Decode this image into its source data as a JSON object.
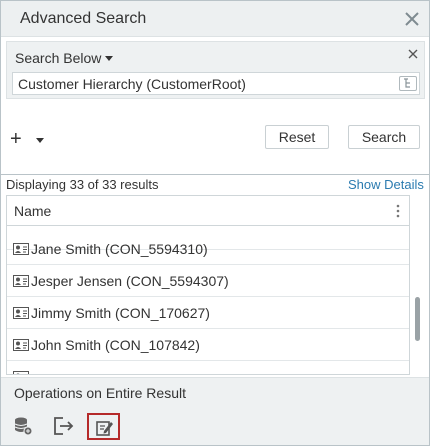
{
  "dialog": {
    "title": "Advanced Search",
    "close_icon": "close-icon"
  },
  "scope": {
    "label": "Search Below",
    "value": "Customer Hierarchy (CustomerRoot)",
    "close_icon": "close-icon",
    "picker_icon": "tree-picker-icon"
  },
  "toolbar": {
    "add_icon": "plus-icon",
    "reset_label": "Reset",
    "search_label": "Search"
  },
  "results": {
    "count_text": "Displaying 33 of 33 results",
    "show_details_label": "Show Details",
    "column_header": "Name",
    "rows": [
      {
        "name": "Jane Smith",
        "id": "(CON_5594310)"
      },
      {
        "name": "Jesper Jensen",
        "id": "(CON_5594307)"
      },
      {
        "name": "Jimmy Smith",
        "id": "(CON_170627)"
      },
      {
        "name": "John Smith",
        "id": "(CON_107842)"
      }
    ]
  },
  "operations": {
    "title": "Operations on Entire Result",
    "buttons": [
      {
        "icon": "database-icon"
      },
      {
        "icon": "export-icon"
      },
      {
        "icon": "bulk-edit-icon",
        "selected": true
      }
    ]
  },
  "colors": {
    "link": "#2b7bb0",
    "selected_border": "#b52a2a",
    "panel_bg": "#eef1f2"
  }
}
